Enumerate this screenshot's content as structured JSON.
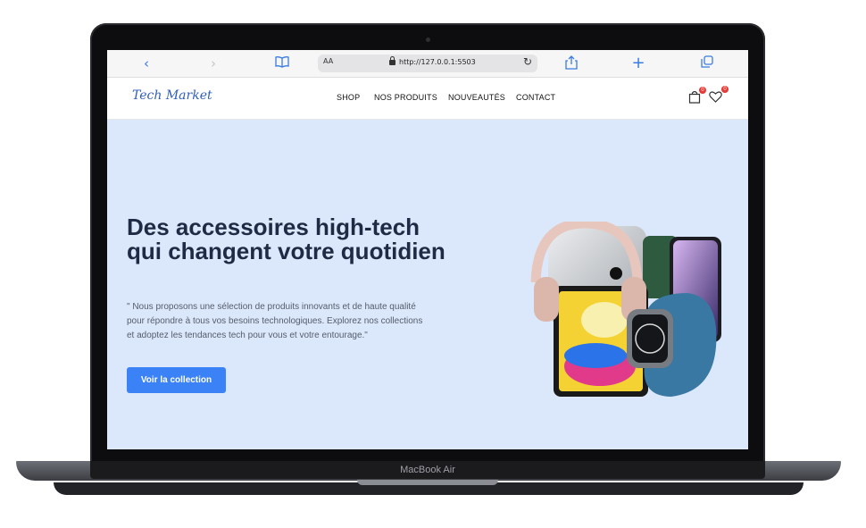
{
  "browser": {
    "reader_label": "AA",
    "url": "http://127.0.0.1:5503",
    "icons": [
      "back-icon",
      "forward-icon",
      "bookmarks-icon",
      "lock-icon",
      "reload-icon",
      "share-icon",
      "new-tab-icon",
      "tabs-icon"
    ]
  },
  "site": {
    "logo": "Tech Market",
    "nav": [
      "SHOP",
      "NOS PRODUITS",
      "NOUVEAUTÉS",
      "CONTACT"
    ],
    "cart_count": "0",
    "wishlist_count": "0"
  },
  "hero": {
    "title": "Des accessoires high-tech qui changent votre quotidien",
    "description": "\" Nous proposons une sélection de produits innovants et de haute qualité pour répondre à tous vos besoins technologiques. Explorez nos collections et adoptez les tendances tech pour vous et votre entourage.\"",
    "cta": "Voir la collection"
  },
  "device_label": "MacBook Air",
  "colors": {
    "accent": "#3b82f6",
    "hero_bg": "#dbe8fb",
    "title": "#1f2b44",
    "badge": "#e53935"
  }
}
